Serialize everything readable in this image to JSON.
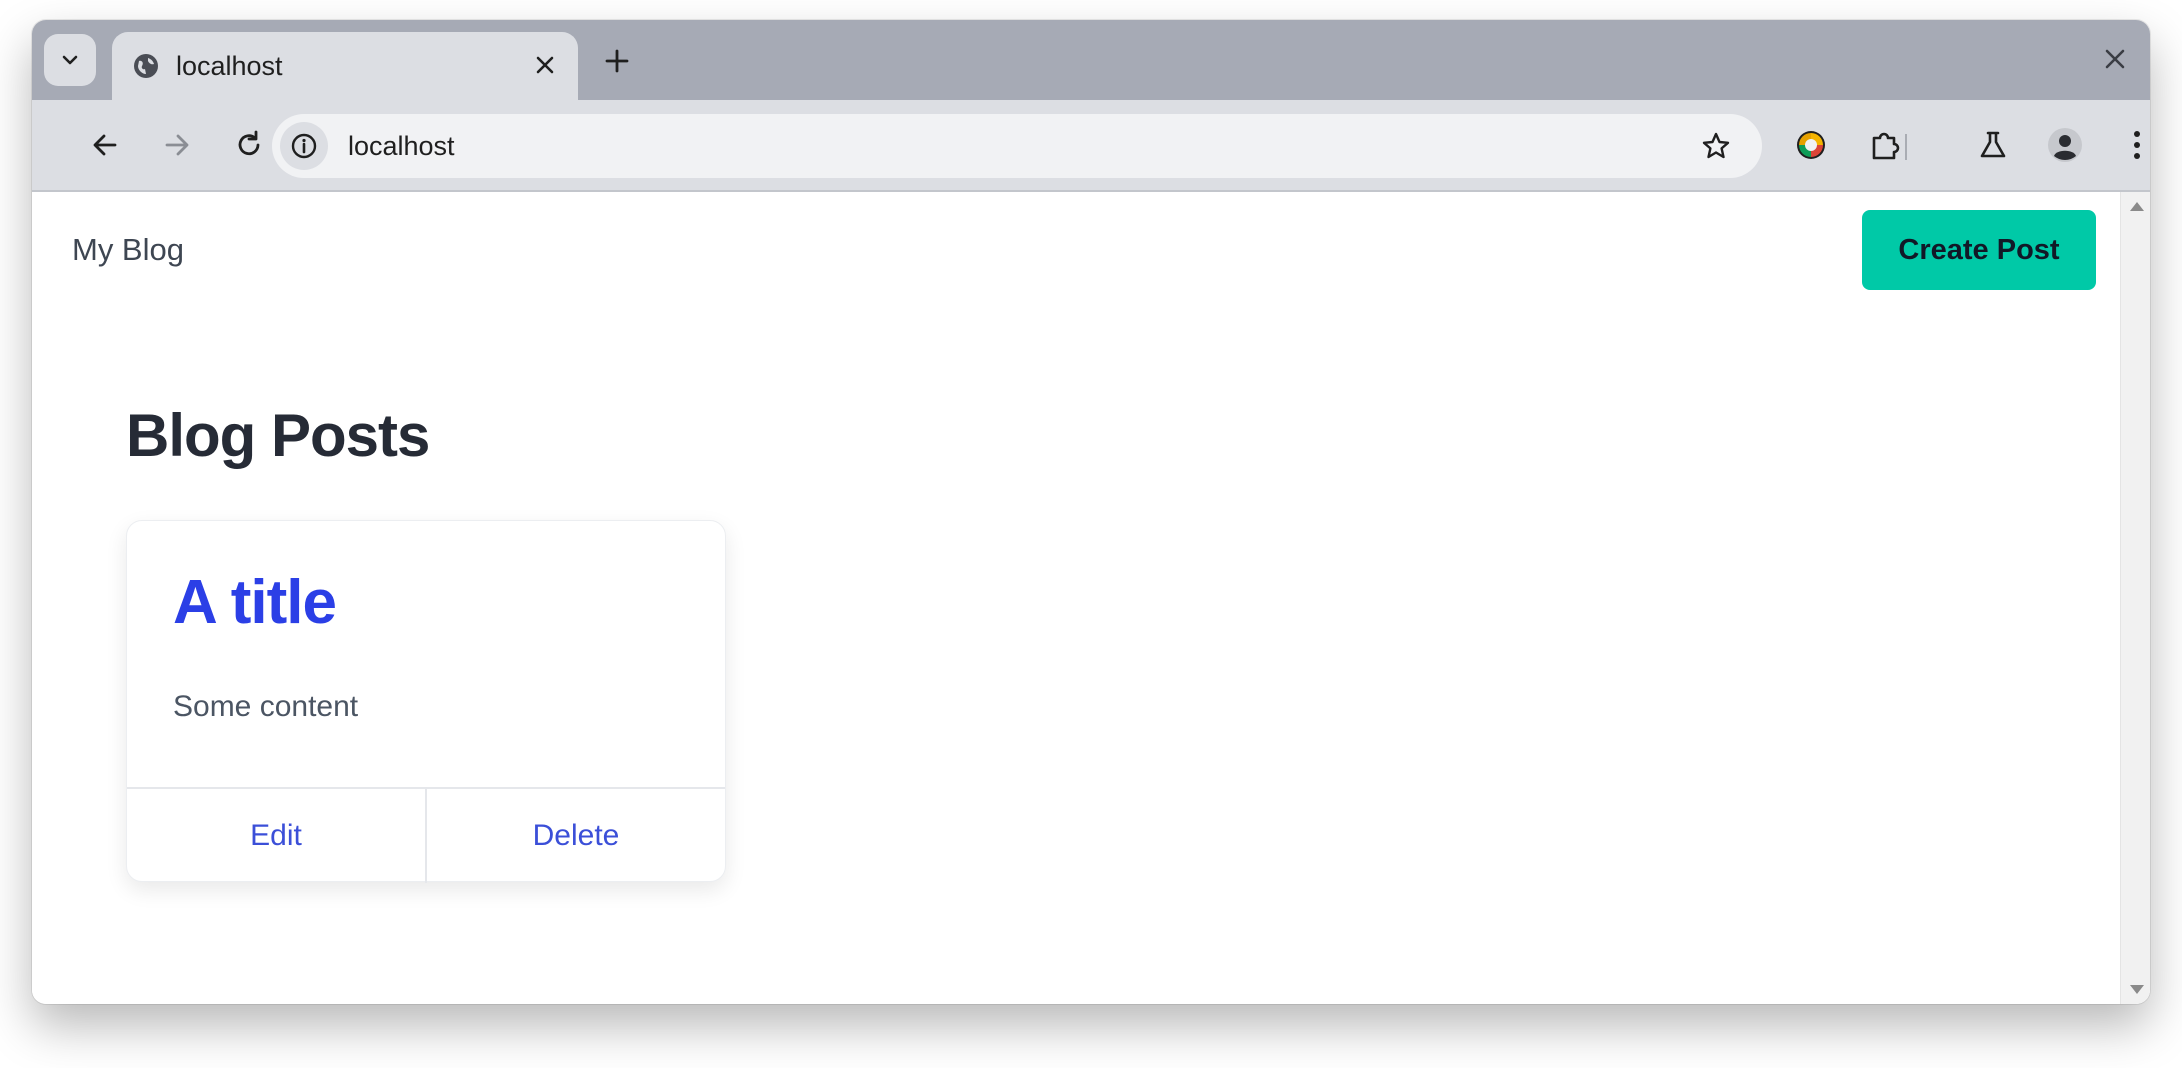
{
  "browser": {
    "tab": {
      "title": "localhost",
      "favicon": "globe-icon"
    },
    "address_bar": {
      "url": "localhost"
    },
    "icons": {
      "tab_search": "chevron-down-icon",
      "tab_close": "close-icon",
      "new_tab": "plus-icon",
      "window_close": "close-icon",
      "back": "arrow-left-icon",
      "forward": "arrow-right-icon",
      "reload": "reload-icon",
      "site_info": "info-icon",
      "bookmark": "star-icon",
      "extension_color": "color-wheel-icon",
      "extensions": "puzzle-icon",
      "labs": "flask-icon",
      "profile": "avatar-icon",
      "menu": "more-vertical-icon"
    }
  },
  "page": {
    "nav": {
      "brand": "My Blog",
      "create_button": "Create Post"
    },
    "heading": "Blog Posts",
    "posts": [
      {
        "title": "A title",
        "content": "Some content",
        "edit_label": "Edit",
        "delete_label": "Delete"
      }
    ]
  },
  "colors": {
    "accent_button": "#00c9a7",
    "link": "#2b3fe6",
    "heading": "#262b36",
    "tabstrip": "#a6aab5",
    "toolbar": "#dcdee3"
  }
}
